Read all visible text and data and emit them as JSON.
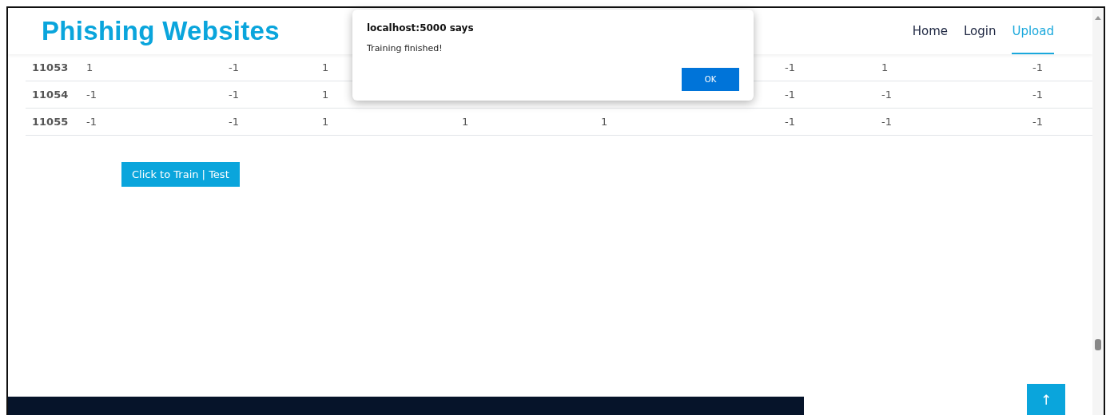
{
  "header": {
    "brand": "Phishing Websites",
    "nav": [
      {
        "label": "Home",
        "selected": false
      },
      {
        "label": "Login",
        "selected": false
      },
      {
        "label": "Upload",
        "selected": true
      }
    ]
  },
  "table": {
    "rows": [
      {
        "id": "11053",
        "cells": [
          "1",
          "-1",
          "1",
          null,
          null,
          "-1",
          "1",
          "-1"
        ]
      },
      {
        "id": "11054",
        "cells": [
          "-1",
          "-1",
          "1",
          null,
          null,
          "-1",
          "-1",
          "-1"
        ]
      },
      {
        "id": "11055",
        "cells": [
          "-1",
          "-1",
          "1",
          "1",
          "1",
          "-1",
          "-1",
          "-1"
        ]
      }
    ]
  },
  "train_button": "Click to Train | Test",
  "back_to_top": "↑",
  "dialog": {
    "title": "localhost:5000 says",
    "message": "Training finished!",
    "button": "OK"
  }
}
